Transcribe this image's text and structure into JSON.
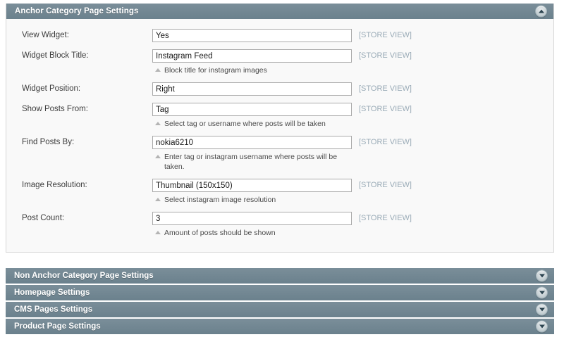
{
  "expanded_section": {
    "title": "Anchor Category Page Settings",
    "toggle_icon": "collapse-circle-up-icon",
    "fields": [
      {
        "label": "View Widget:",
        "value": "Yes",
        "hint": "",
        "scope": "[STORE VIEW]"
      },
      {
        "label": "Widget Block Title:",
        "value": "Instagram Feed",
        "hint": "Block title for instagram images",
        "scope": "[STORE VIEW]"
      },
      {
        "label": "Widget Position:",
        "value": "Right",
        "hint": "",
        "scope": "[STORE VIEW]"
      },
      {
        "label": "Show Posts From:",
        "value": "Tag",
        "hint": "Select tag or username where posts will be taken",
        "scope": "[STORE VIEW]"
      },
      {
        "label": "Find Posts By:",
        "value": "nokia6210",
        "hint": "Enter tag or instagram username where posts will be taken.",
        "scope": "[STORE VIEW]"
      },
      {
        "label": "Image Resolution:",
        "value": "Thumbnail (150x150)",
        "hint": "Select instagram image resolution",
        "scope": "[STORE VIEW]"
      },
      {
        "label": "Post Count:",
        "value": "3",
        "hint": "Amount of posts should be shown",
        "scope": "[STORE VIEW]"
      }
    ]
  },
  "collapsed_sections": [
    {
      "title": "Non Anchor Category Page Settings",
      "toggle_icon": "expand-circle-down-icon"
    },
    {
      "title": "Homepage Settings",
      "toggle_icon": "expand-circle-down-icon"
    },
    {
      "title": "CMS Pages Settings",
      "toggle_icon": "expand-circle-down-icon"
    },
    {
      "title": "Product Page Settings",
      "toggle_icon": "expand-circle-down-icon"
    }
  ],
  "colors": {
    "header_bar": "#6f8591",
    "panel_body": "#f9f9f9",
    "panel_border": "#d6d6d6",
    "scope_label": "#9aabb7",
    "input_border": "#aaaaaa"
  }
}
